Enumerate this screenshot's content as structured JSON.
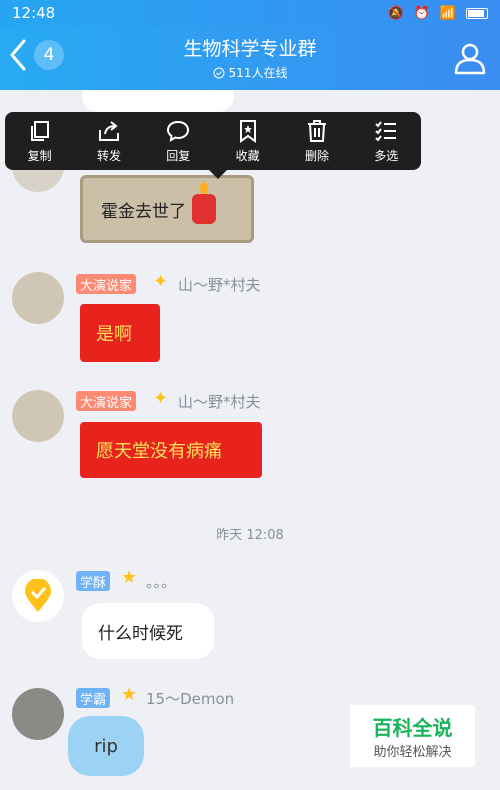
{
  "status_bar": {
    "time": "12:48"
  },
  "header": {
    "back_count": "4",
    "title": "生物科学专业群",
    "online": "511人在线"
  },
  "context_menu": {
    "items": [
      {
        "label": "复制",
        "icon": "copy-icon"
      },
      {
        "label": "转发",
        "icon": "forward-icon"
      },
      {
        "label": "回复",
        "icon": "reply-icon"
      },
      {
        "label": "收藏",
        "icon": "bookmark-icon"
      },
      {
        "label": "删除",
        "icon": "trash-icon"
      },
      {
        "label": "多选",
        "icon": "multi-select-icon"
      }
    ]
  },
  "messages": {
    "m1": {
      "text": "霍金去世了"
    },
    "m2": {
      "tag": "大演说家",
      "nick": "山～野*村夫",
      "text": "是啊"
    },
    "m3": {
      "tag": "大演说家",
      "nick": "山～野*村夫",
      "text": "愿天堂没有病痛"
    },
    "timestamp": "昨天 12:08",
    "m4": {
      "tag": "学酥",
      "nick": "。。。",
      "text": "什么时候死"
    },
    "m5": {
      "tag": "学霸",
      "nick": "15～Demon",
      "text": "rip"
    }
  },
  "watermark": {
    "title": "百科全说",
    "subtitle": "助你轻松解决"
  },
  "colors": {
    "header": "#3a97f2",
    "menu": "#1f1f1f",
    "tag_orange": "#ff8a73",
    "tag_blue": "#6fb2f5"
  }
}
